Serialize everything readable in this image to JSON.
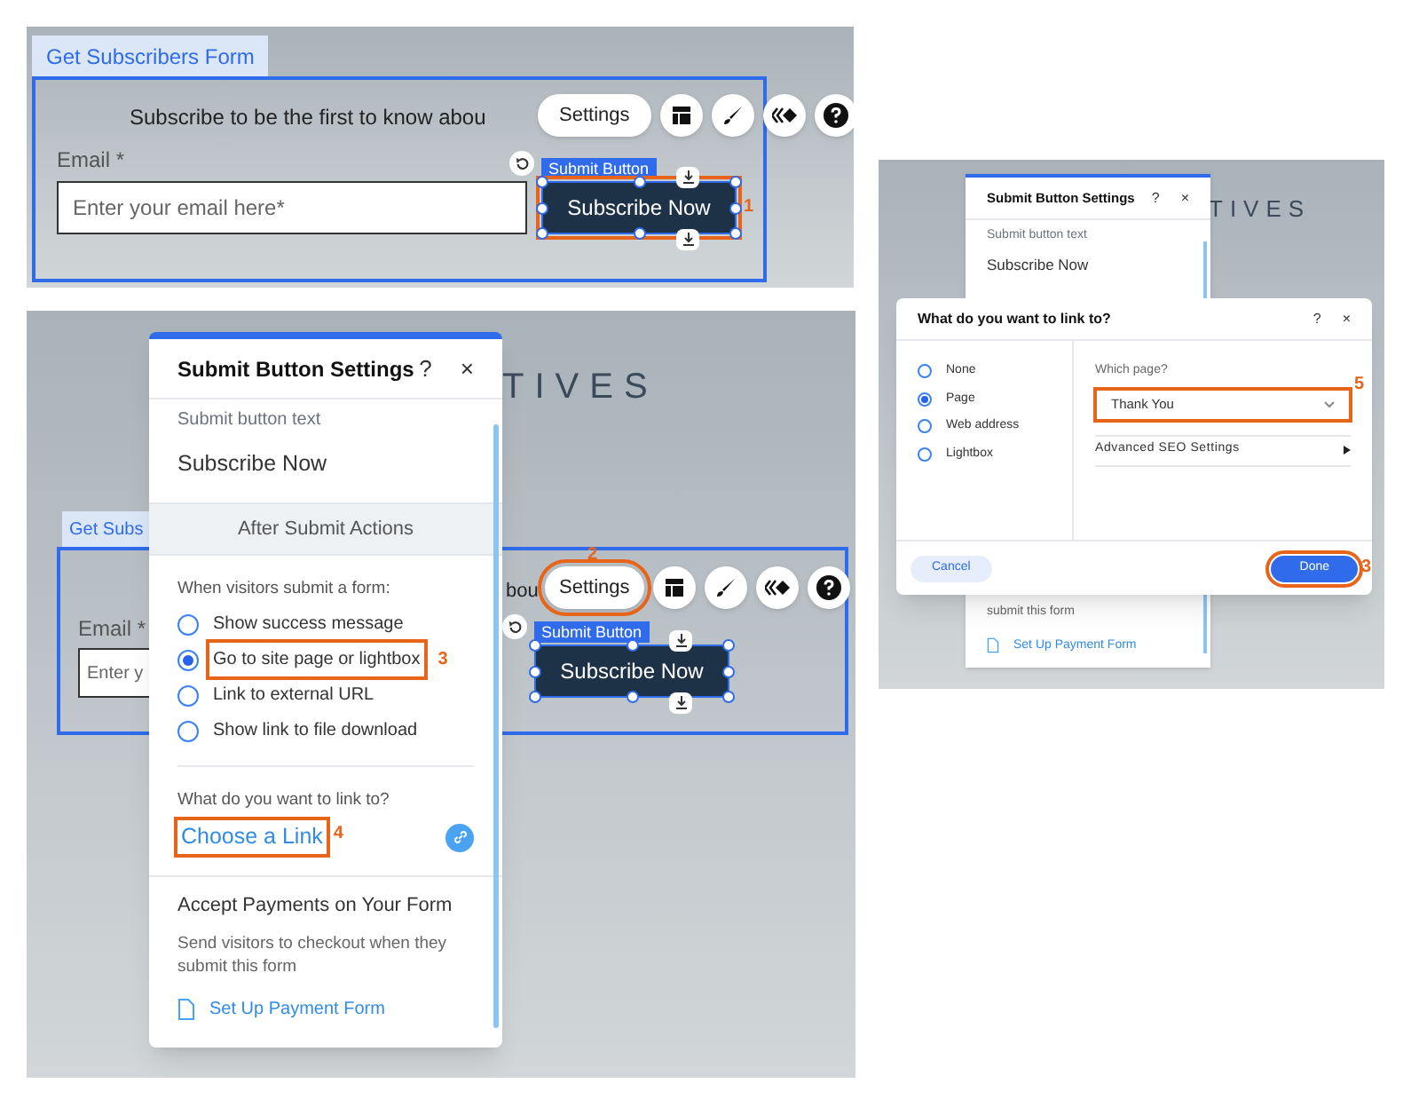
{
  "editor_1": {
    "form_tab": "Get Subscribers Form",
    "heading": "Subscribe to be the first to know abou",
    "email_label": "Email *",
    "email_placeholder": "Enter your email here*",
    "button_tag": "Submit Button",
    "submit_button": "Subscribe Now",
    "settings": "Settings",
    "callout": "1"
  },
  "editor_2": {
    "backdrop_title": "TIVES",
    "form_tab": "Get Subs",
    "heading": "bou",
    "email_label": "Email *",
    "email_placeholder": "Enter y",
    "button_tag": "Submit Button",
    "submit_button": "Subscribe Now",
    "settings": "Settings",
    "settings_callout": "2",
    "panel": {
      "title": "Submit Button Settings",
      "help": "?",
      "close": "×",
      "text_label": "Submit button text",
      "text_value": "Subscribe Now",
      "section": "After Submit Actions",
      "prompt": "When visitors submit a form:",
      "options": [
        {
          "label": "Show success message",
          "selected": false
        },
        {
          "label": "Go to site page or lightbox",
          "selected": true
        },
        {
          "label": "Link to external URL",
          "selected": false
        },
        {
          "label": "Show link to file download",
          "selected": false
        }
      ],
      "option_callout": "3",
      "link_prompt": "What do you want to link to?",
      "link": "Choose a Link",
      "link_callout": "4",
      "payments_title": "Accept Payments on Your Form",
      "payments_text": "Send visitors to checkout when they submit this form",
      "payments_link": "Set Up Payment Form"
    }
  },
  "editor_3": {
    "backdrop_title": "TIVES",
    "panel": {
      "title": "Submit Button Settings",
      "help": "?",
      "close": "×",
      "text_label": "Submit button text",
      "text_value": "Subscribe Now",
      "payments_text": "submit this form",
      "payments_link": "Set Up Payment Form"
    },
    "dialog": {
      "title": "What do you want to link to?",
      "help": "?",
      "close": "×",
      "options": [
        {
          "label": "None",
          "selected": false
        },
        {
          "label": "Page",
          "selected": true
        },
        {
          "label": "Web address",
          "selected": false
        },
        {
          "label": "Lightbox",
          "selected": false
        }
      ],
      "page_label": "Which page?",
      "page_value": "Thank You",
      "page_callout": "5",
      "seo": "Advanced SEO Settings",
      "cancel": "Cancel",
      "done": "Done",
      "done_callout": "3"
    }
  }
}
